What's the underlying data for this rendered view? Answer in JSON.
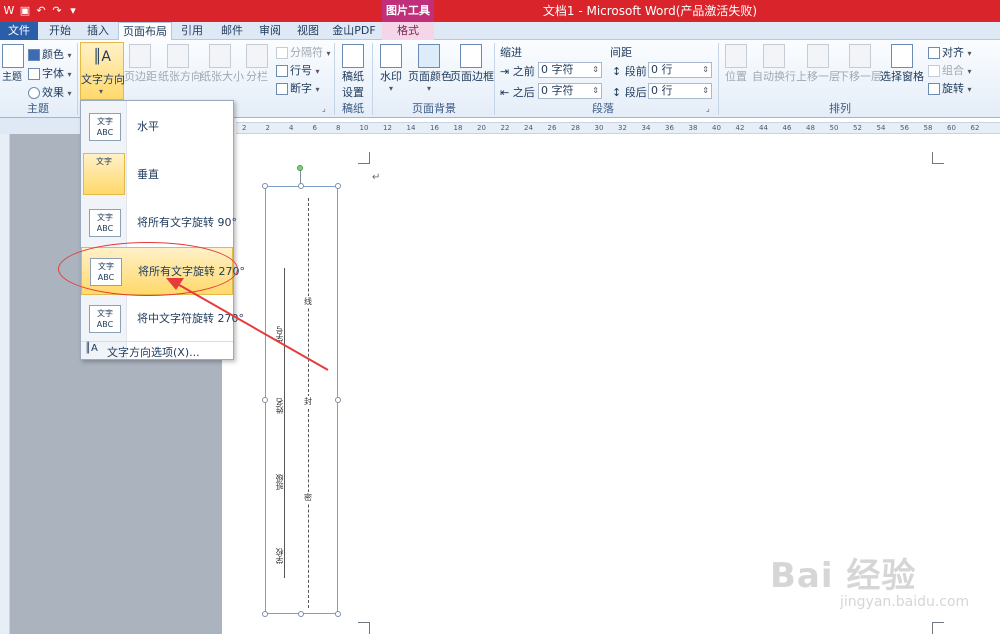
{
  "window": {
    "title": "文档1 - Microsoft Word(产品激活失败)",
    "context_tool": "图片工具"
  },
  "tabs": {
    "file": "文件",
    "home": "开始",
    "insert": "插入",
    "layout": "页面布局",
    "references": "引用",
    "mailings": "邮件",
    "review": "审阅",
    "view": "视图",
    "jinshan": "金山PDF",
    "format": "格式"
  },
  "ribbon": {
    "themes": {
      "theme": "主题",
      "colors": "颜色",
      "fonts": "字体",
      "effects": "效果",
      "group": "主题"
    },
    "page_setup": {
      "text_direction": "文字方向",
      "margins": "页边距",
      "orientation": "纸张方向",
      "size": "纸张大小",
      "columns": "分栏",
      "breaks": "分隔符",
      "line_numbers": "行号",
      "hyphenation": "断字"
    },
    "draft": {
      "draft_setting_1": "稿纸",
      "draft_setting_2": "设置",
      "group": "稿纸"
    },
    "page_background": {
      "watermark": "水印",
      "page_color": "页面颜色",
      "page_borders": "页面边框",
      "group": "页面背景"
    },
    "paragraph": {
      "indent": "缩进",
      "spacing": "间距",
      "before_indent_label": "之前",
      "after_indent_label": "之后",
      "indent_before_value": "0 字符",
      "indent_after_value": "0 字符",
      "spacing_before_label": "段前",
      "spacing_after_label": "段后",
      "spacing_before_value": "0 行",
      "spacing_after_value": "0 行",
      "group": "段落"
    },
    "arrange": {
      "position": "位置",
      "wrap_text": "自动换行",
      "bring_forward": "上移一层",
      "send_backward": "下移一层",
      "selection_pane": "选择窗格",
      "align": "对齐",
      "group_objects": "组合",
      "rotate": "旋转",
      "group": "排列"
    }
  },
  "ruler_marks": [
    "2",
    "2",
    "4",
    "6",
    "8",
    "10",
    "12",
    "14",
    "16",
    "18",
    "20",
    "22",
    "24",
    "26",
    "28",
    "30",
    "32",
    "34",
    "36",
    "38",
    "40",
    "42",
    "44",
    "46",
    "48",
    "50",
    "52",
    "54",
    "56",
    "58",
    "60",
    "62"
  ],
  "text_direction_menu": {
    "items": [
      {
        "label": "水平",
        "icon_text": "文字ABC"
      },
      {
        "label": "垂直",
        "icon_text": "文字"
      },
      {
        "label": "将所有文字旋转 90°",
        "icon_text": "文字ABC"
      },
      {
        "label": "将所有文字旋转 270°",
        "icon_text": "文字ABC"
      },
      {
        "label": "将中文字符旋转 270°",
        "icon_text": "文字ABC"
      }
    ],
    "options": "文字方向选项(X)..."
  },
  "document": {
    "paragraph_mark": "↵",
    "labels": [
      "学号",
      "姓名",
      "班级",
      "学校"
    ],
    "dashed_chars": [
      "线",
      "封",
      "密"
    ]
  },
  "watermark": {
    "brand": "Bai 经验",
    "url": "jingyan.baidu.com"
  },
  "colors": {
    "title_bar": "#d8242a",
    "accent_tab": "#2a5ea8",
    "context_tab": "#c0307a",
    "highlight": "#ffd96a",
    "annotation": "#e53b3b"
  }
}
